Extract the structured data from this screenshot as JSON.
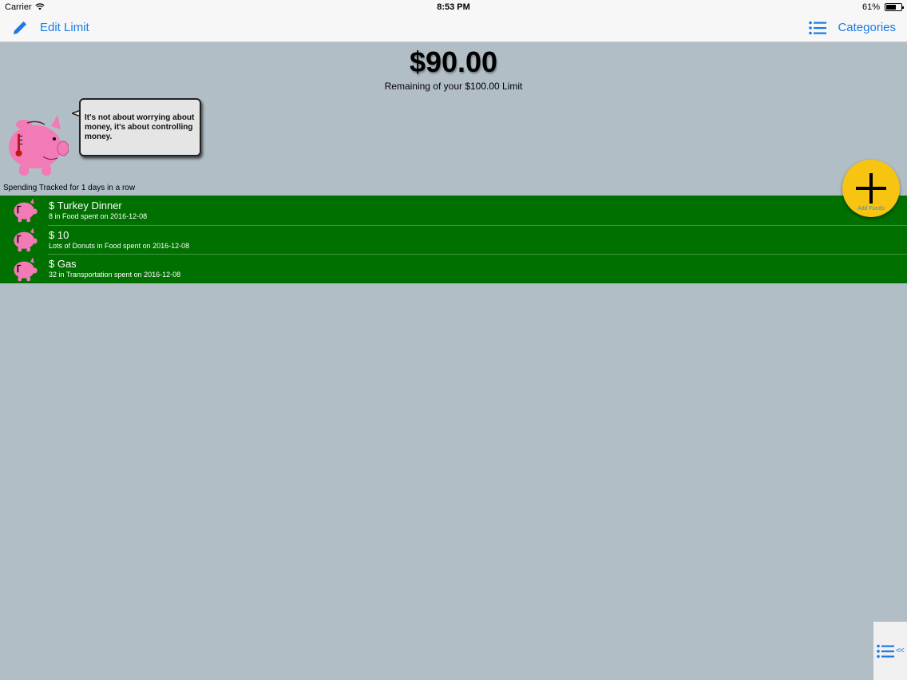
{
  "status_bar": {
    "carrier": "Carrier",
    "time": "8:53 PM",
    "battery": "61%",
    "battery_level": 0.61
  },
  "nav": {
    "edit_label": "Edit Limit",
    "categories_label": "Categories",
    "accent_color": "#1b7ae4"
  },
  "summary": {
    "remaining_amount": "$90.00",
    "remaining_text": "Remaining of your $100.00 Limit"
  },
  "mascot": {
    "icon": "piggy-bank-icon",
    "quote": "It's not about worrying about money, it's about controlling money."
  },
  "streak_text": "Spending Tracked for 1 days in a row",
  "transactions": [
    {
      "title": "$ Turkey Dinner",
      "subtitle": "8 in Food spent on 2016-12-08"
    },
    {
      "title": "$ 10",
      "subtitle": "Lots of Donuts in Food spent on 2016-12-08"
    },
    {
      "title": "$ Gas",
      "subtitle": "32 in Transportation spent on 2016-12-08"
    }
  ],
  "add_funds": {
    "label": "Add Funds",
    "color": "#f8c412"
  },
  "side_tab": {
    "arrows": "<<"
  },
  "colors": {
    "background": "#b2bec6",
    "list_background": "#007000",
    "pig": "#f27ab6"
  }
}
